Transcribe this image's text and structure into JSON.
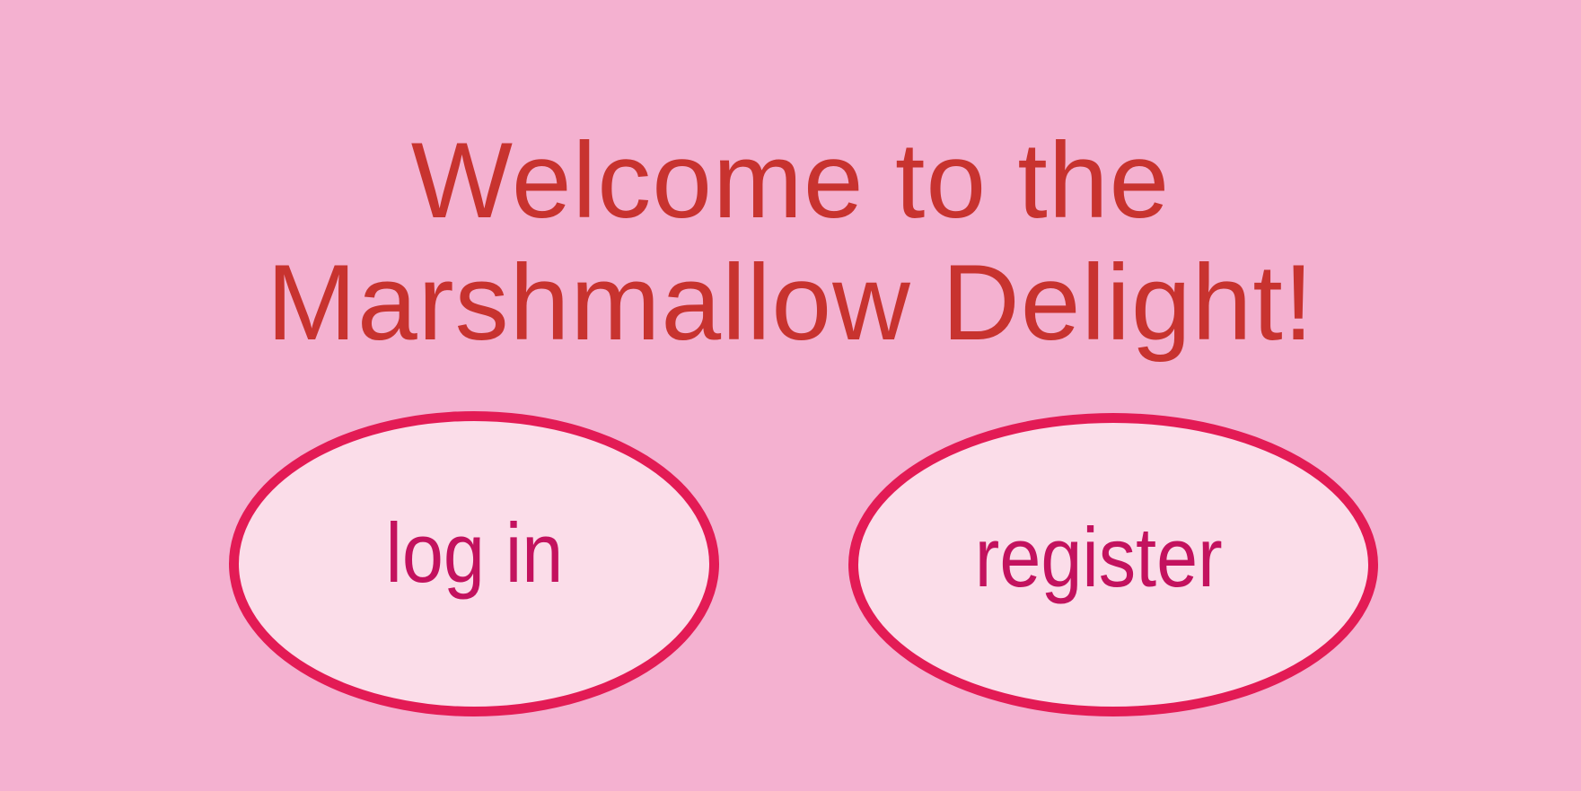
{
  "page": {
    "title_line1": "Welcome to the",
    "title_line2": "Marshmallow Delight!"
  },
  "actions": {
    "login_label": "log in",
    "register_label": "register"
  },
  "colors": {
    "background": "#f4b1d0",
    "title_text": "#c8332f",
    "button_fill": "#fbdde9",
    "button_border": "#e31b55",
    "button_text": "#c3125e"
  }
}
